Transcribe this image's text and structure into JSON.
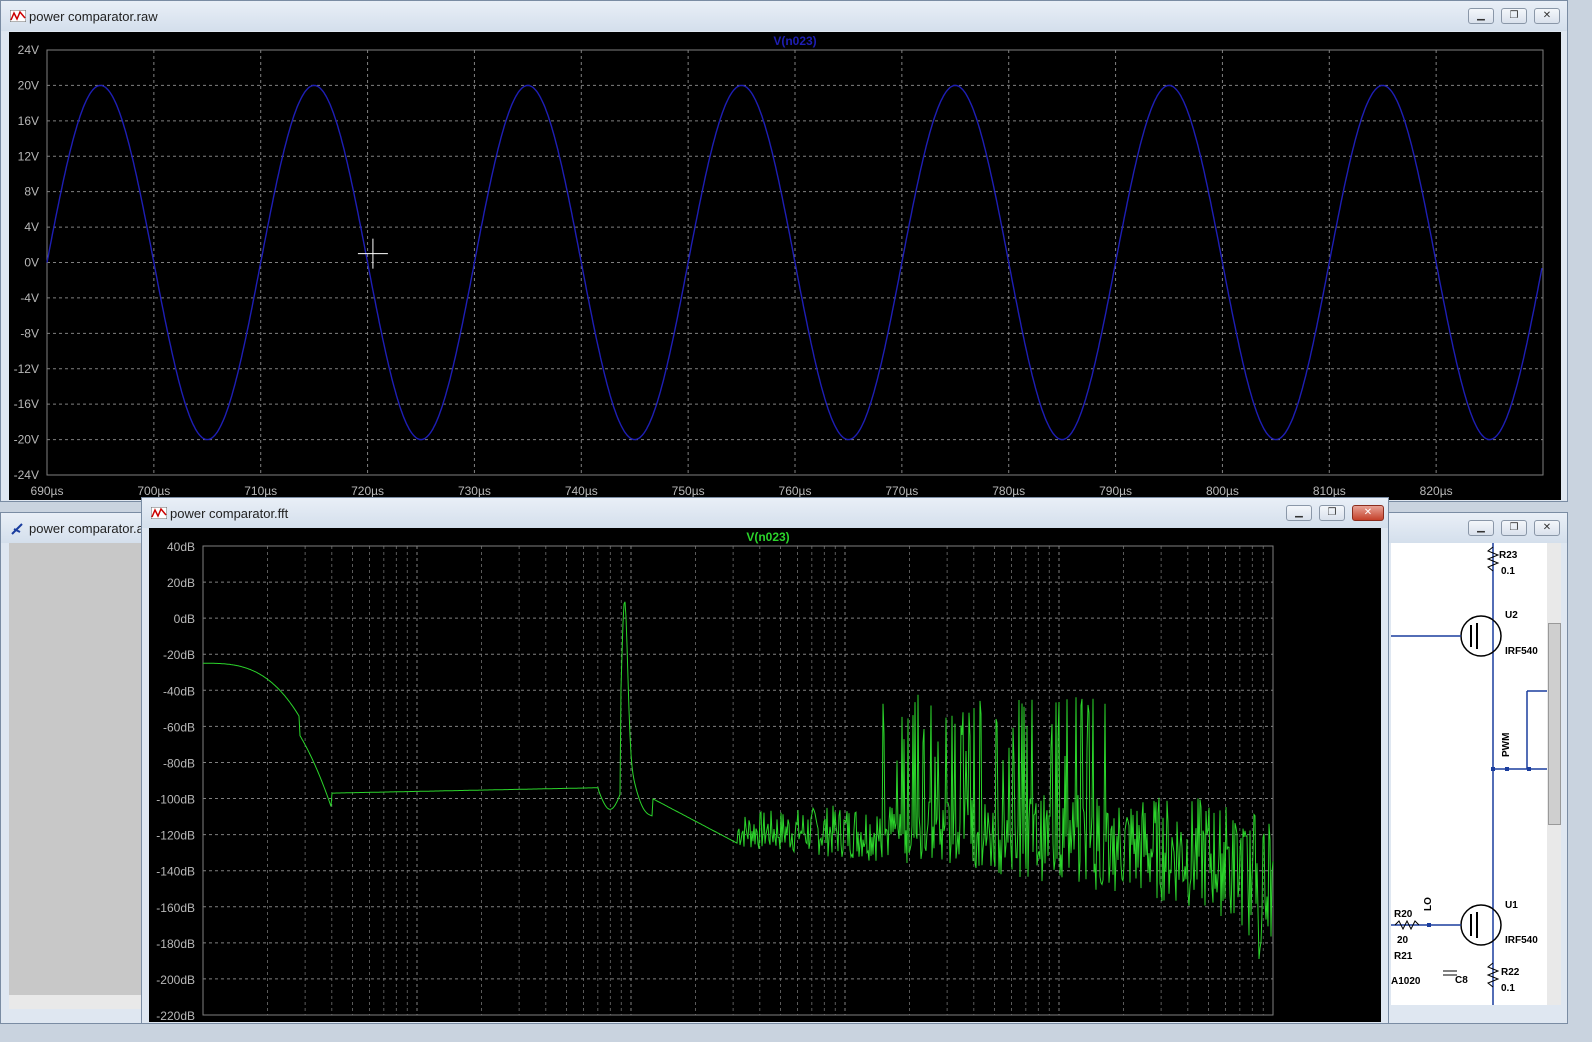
{
  "raw_window": {
    "title": "power comparator.raw",
    "trace_label": "V(n023)",
    "trace_color": "#1e1eb4",
    "chart_data": {
      "type": "line",
      "title": "V(n023)",
      "xlabel": "",
      "ylabel": "",
      "x_ticks": [
        "690µs",
        "700µs",
        "710µs",
        "720µs",
        "730µs",
        "740µs",
        "750µs",
        "760µs",
        "770µs",
        "780µs",
        "790µs",
        "800µs",
        "810µs",
        "820µs"
      ],
      "y_ticks": [
        "24V",
        "20V",
        "16V",
        "12V",
        "8V",
        "4V",
        "0V",
        "-4V",
        "-8V",
        "-12V",
        "-16V",
        "-20V",
        "-24V"
      ],
      "xlim": [
        690,
        830
      ],
      "ylim": [
        -24,
        24
      ],
      "series": [
        {
          "amplitude": 20,
          "period": 20,
          "phase_start": 690,
          "values_desc": "sinusoid"
        }
      ],
      "grid": true
    }
  },
  "fft_window": {
    "title": "power comparator.fft",
    "trace_label": "V(n023)",
    "trace_color": "#2bd42b",
    "chart_data": {
      "type": "line",
      "title": "V(n023)",
      "y_ticks": [
        "40dB",
        "20dB",
        "0dB",
        "-20dB",
        "-40dB",
        "-60dB",
        "-80dB",
        "-100dB",
        "-120dB",
        "-140dB",
        "-160dB",
        "-180dB",
        "-200dB",
        "-220dB"
      ],
      "ylim": [
        -220,
        40
      ],
      "x_scale": "log",
      "grid": true
    }
  },
  "asc_window": {
    "title": "power comparator.asc",
    "labels": [
      "R23",
      "0.1",
      "U2",
      "IRF540",
      "PWM",
      "U1",
      "IRF540",
      "R20",
      "20",
      "LO",
      "R21",
      "A1020",
      "C8",
      "R22",
      "0.1"
    ]
  },
  "buttons": {
    "minimize": "▁",
    "restore": "❐",
    "close": "✕"
  },
  "cursor": {
    "x_value": 720.5,
    "y_value": 1.0
  }
}
